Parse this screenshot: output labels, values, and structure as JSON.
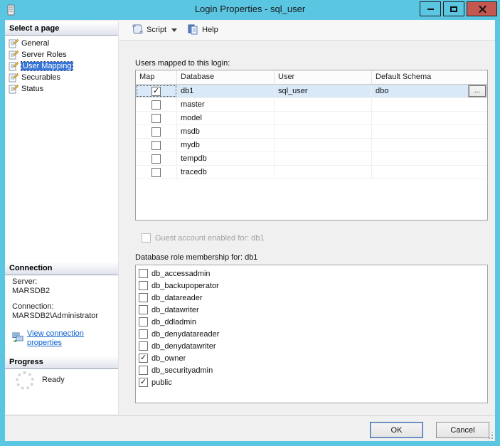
{
  "window": {
    "title": "Login Properties - sql_user"
  },
  "sidebar": {
    "select_page": {
      "header": "Select a page",
      "items": [
        {
          "label": "General",
          "selected": false
        },
        {
          "label": "Server Roles",
          "selected": false
        },
        {
          "label": "User Mapping",
          "selected": true
        },
        {
          "label": "Securables",
          "selected": false
        },
        {
          "label": "Status",
          "selected": false
        }
      ]
    },
    "connection": {
      "header": "Connection",
      "server_label": "Server:",
      "server_value": "MARSDB2",
      "connection_label": "Connection:",
      "connection_value": "MARSDB2\\Administrator",
      "link_label": "View connection properties"
    },
    "progress": {
      "header": "Progress",
      "status": "Ready"
    }
  },
  "toolbar": {
    "script_label": "Script",
    "help_label": "Help"
  },
  "content": {
    "users_caption": "Users mapped to this login:",
    "table": {
      "columns": [
        "Map",
        "Database",
        "User",
        "Default Schema"
      ],
      "rows": [
        {
          "map": true,
          "database": "db1",
          "user": "sql_user",
          "default_schema": "dbo",
          "selected": true,
          "browse_label": "..."
        },
        {
          "map": false,
          "database": "master",
          "user": "",
          "default_schema": ""
        },
        {
          "map": false,
          "database": "model",
          "user": "",
          "default_schema": ""
        },
        {
          "map": false,
          "database": "msdb",
          "user": "",
          "default_schema": ""
        },
        {
          "map": false,
          "database": "mydb",
          "user": "",
          "default_schema": ""
        },
        {
          "map": false,
          "database": "tempdb",
          "user": "",
          "default_schema": ""
        },
        {
          "map": false,
          "database": "tracedb",
          "user": "",
          "default_schema": ""
        }
      ]
    },
    "guest_label": "Guest account enabled for: db1",
    "roles_caption": "Database role membership for: db1",
    "roles": [
      {
        "label": "db_accessadmin",
        "checked": false
      },
      {
        "label": "db_backupoperator",
        "checked": false
      },
      {
        "label": "db_datareader",
        "checked": false
      },
      {
        "label": "db_datawriter",
        "checked": false
      },
      {
        "label": "db_ddladmin",
        "checked": false
      },
      {
        "label": "db_denydatareader",
        "checked": false
      },
      {
        "label": "db_denydatawriter",
        "checked": false
      },
      {
        "label": "db_owner",
        "checked": true
      },
      {
        "label": "db_securityadmin",
        "checked": false
      },
      {
        "label": "public",
        "checked": true
      }
    ]
  },
  "footer": {
    "ok_label": "OK",
    "cancel_label": "Cancel"
  },
  "colors": {
    "frame": "#5bc6e2",
    "close_button": "#c4574f",
    "selection": "#3875d7",
    "selection_text": "#ffffff",
    "row_selected": "#d9e9f8",
    "link": "#0b5fcb",
    "disabled_text": "#a3a3a3"
  },
  "glyphs": {
    "check": "✓"
  }
}
